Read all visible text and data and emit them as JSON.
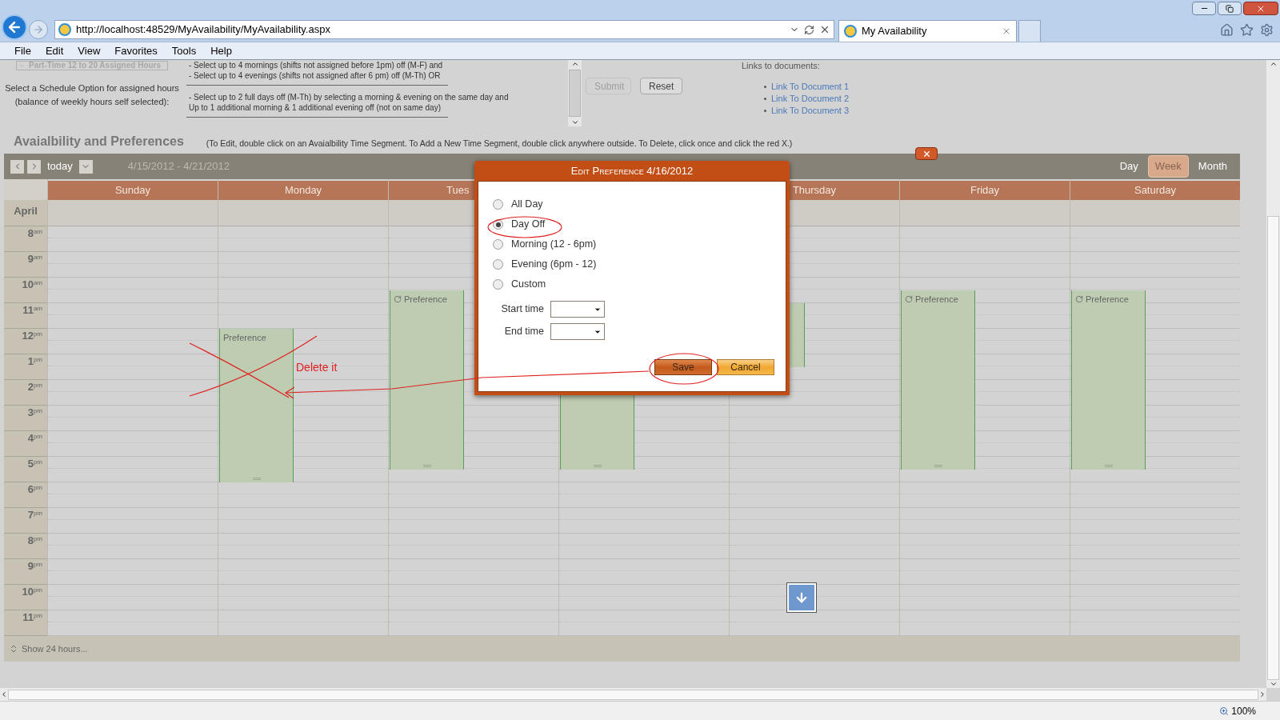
{
  "browser": {
    "url": "http://localhost:48529/MyAvailability/MyAvailability.aspx",
    "tab_title": "My Availability",
    "menu": [
      "File",
      "Edit",
      "View",
      "Favorites",
      "Tools",
      "Help"
    ],
    "zoom": "100%"
  },
  "schedule_form": {
    "dropdown": "Part-Time 12 to 20 Assigned Hours",
    "label_lines": [
      "Select a Schedule Option for assigned hours",
      "(balance of weekly hours self selected):"
    ],
    "option_groups": [
      [
        "- Select up to 4 mornings (shifts not assigned before 1pm) off (M-F) and",
        "- Select up to 4 evenings (shifts not assigned after 6 pm) off (M-Th) OR"
      ],
      [
        "- Select up to 2 full days off (M-Th) by selecting a morning & evening on the same day and",
        "Up to 1 additional morning & 1 additional evening off (not on same day)"
      ]
    ],
    "buttons": [
      {
        "label": "Submit",
        "disabled": true
      },
      {
        "label": "Reset",
        "disabled": false
      }
    ],
    "links_heading": "Links to documents:",
    "links": [
      "Link To Document 1",
      "Link To Document 2",
      "Link To Document 3"
    ]
  },
  "calendar": {
    "title": "Avaialbility and Preferences",
    "hint": "(To Edit, double click on an Avaialbility Time Segment. To Add a New Time Segment, double click anywhere outside. To Delete, click once and click the red X.)",
    "today": "today",
    "date_range": "4/15/2012 - 4/21/2012",
    "views": [
      {
        "label": "Day",
        "selected": false
      },
      {
        "label": "Week",
        "selected": true
      },
      {
        "label": "Month",
        "selected": false
      }
    ],
    "all_day_label": "April",
    "hours": [
      {
        "hour": "8",
        "suffix": "am"
      },
      {
        "hour": "9",
        "suffix": "am"
      },
      {
        "hour": "10",
        "suffix": "am"
      },
      {
        "hour": "11",
        "suffix": "am"
      },
      {
        "hour": "12",
        "suffix": "pm"
      },
      {
        "hour": "1",
        "suffix": "pm"
      },
      {
        "hour": "2",
        "suffix": "pm"
      },
      {
        "hour": "3",
        "suffix": "pm"
      },
      {
        "hour": "4",
        "suffix": "pm"
      },
      {
        "hour": "5",
        "suffix": "pm"
      },
      {
        "hour": "6",
        "suffix": "pm"
      },
      {
        "hour": "7",
        "suffix": "pm"
      },
      {
        "hour": "8",
        "suffix": "pm"
      },
      {
        "hour": "9",
        "suffix": "pm"
      },
      {
        "hour": "10",
        "suffix": "pm"
      },
      {
        "hour": "11",
        "suffix": "pm"
      }
    ],
    "days": [
      {
        "name": "Sunday",
        "partial": false
      },
      {
        "name": "Monday",
        "partial": false,
        "events": [
          {
            "kind": "segment",
            "label": "Preference",
            "recurring": false
          }
        ]
      },
      {
        "name": "Tues",
        "partial": true,
        "events": [
          {
            "kind": "segment",
            "label": "Preference",
            "recurring": true
          }
        ]
      },
      {
        "events": [
          {
            "kind": "segment"
          }
        ]
      },
      {
        "name": "Thursday",
        "partial": false,
        "events": [
          {
            "kind": "segment"
          }
        ]
      },
      {
        "name": "Friday",
        "partial": false,
        "events": [
          {
            "kind": "segment",
            "label": "Preference",
            "recurring": true
          }
        ]
      },
      {
        "name": "Saturday",
        "partial": false,
        "events": [
          {
            "kind": "segment",
            "label": "Preference",
            "recurring": true
          }
        ]
      }
    ],
    "show_more": "Show 24 hours..."
  },
  "dialog": {
    "title": "Edit Preference 4/16/2012",
    "options": [
      {
        "label": "All Day",
        "selected": false
      },
      {
        "label": "Day Off",
        "selected": true
      },
      {
        "label": "Morning (12 - 6pm)",
        "selected": false
      },
      {
        "label": "Evening (6pm - 12)",
        "selected": false
      },
      {
        "label": "Custom",
        "selected": false
      }
    ],
    "fields": [
      {
        "label": "Start time"
      },
      {
        "label": "End time"
      }
    ],
    "buttons": [
      {
        "label": "Save",
        "kind": "primary"
      },
      {
        "label": "Cancel",
        "kind": "secondary"
      }
    ]
  },
  "annotation": {
    "text": "Delete it"
  }
}
